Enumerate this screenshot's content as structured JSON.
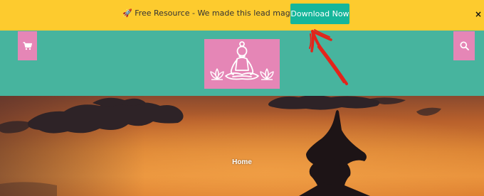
{
  "notice_bar": {
    "text": "🚀 Free Resource - We made this lead magnet for you.",
    "button_label": "Download Now",
    "close_label": "×",
    "bg_color": "#fdcb2e",
    "button_color": "#16b69b"
  },
  "header": {
    "bg_color": "#47b49e",
    "accent_color": "#e586b6",
    "cart_icon": "cart-icon",
    "search_icon": "search-icon",
    "logo_icon": "meditation-figure-icon"
  },
  "hero": {
    "title": "Home"
  },
  "annotation": {
    "color": "#e3241b",
    "icon": "hand-drawn-arrow-icon"
  }
}
